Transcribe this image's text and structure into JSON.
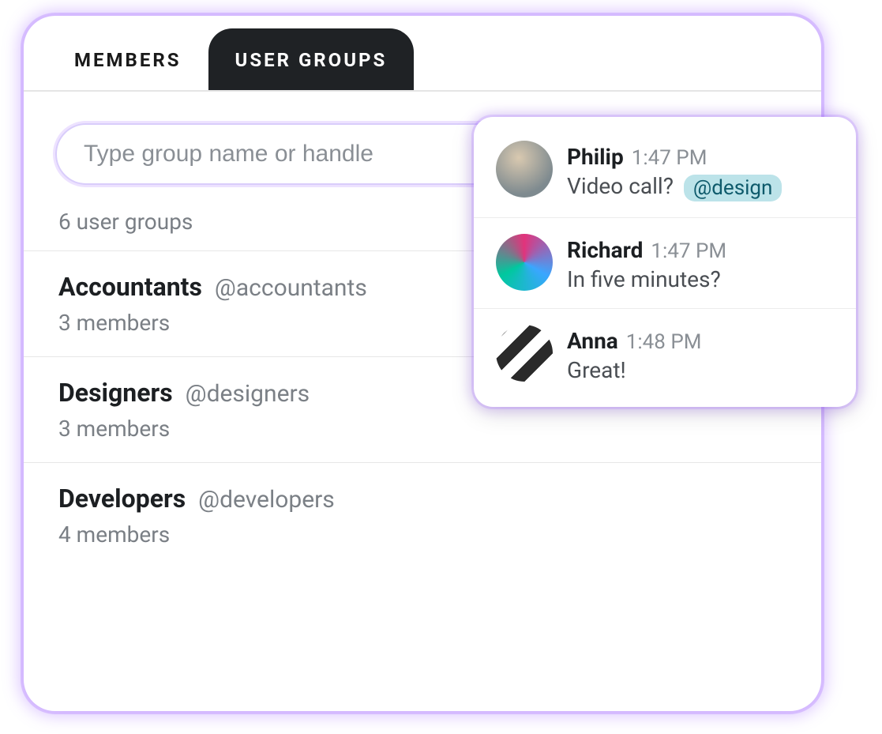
{
  "tabs": {
    "members": "MEMBERS",
    "user_groups": "USER GROUPS"
  },
  "search": {
    "placeholder": "Type group name or handle",
    "value": ""
  },
  "groups_count_label": "6 user groups",
  "groups": [
    {
      "name": "Accountants",
      "handle": "@accountants",
      "members_label": "3 members"
    },
    {
      "name": "Designers",
      "handle": "@designers",
      "members_label": "3 members"
    },
    {
      "name": "Developers",
      "handle": "@developers",
      "members_label": "4 members"
    }
  ],
  "chat": [
    {
      "name": "Philip",
      "time": "1:47 PM",
      "text": "Video call?",
      "mention": "@design"
    },
    {
      "name": "Richard",
      "time": "1:47 PM",
      "text": "In five minutes?"
    },
    {
      "name": "Anna",
      "time": "1:48 PM",
      "text": "Great!"
    }
  ]
}
